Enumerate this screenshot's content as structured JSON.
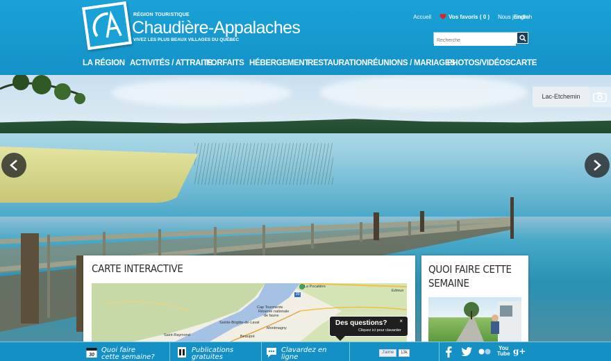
{
  "brand": {
    "kicker": "RÉGION TOURISTIQUE",
    "name": "Chaudière-Appalaches",
    "tagline": "VIVEZ LES PLUS BEAUX VILLAGES DU QUÉBEC"
  },
  "toplinks": {
    "home": "Accueil",
    "favorites": "Vos favoris ( 0 )",
    "contact": "Nous joindre",
    "language": "English"
  },
  "search": {
    "placeholder": "Recherche"
  },
  "nav": [
    "LA RÉGION",
    "ACTIVITÉS / ATTRAITS",
    "FORFAITS",
    "HÉBERGEMENT",
    "RESTAURATION",
    "RÉUNIONS / MARIAGES",
    "PHOTOS/VIDÉOS",
    "CARTE"
  ],
  "hero": {
    "location": "Lac-Etchemin"
  },
  "panels": {
    "map_title": "CARTE INTERACTIVE",
    "week_title": "QUOI FAIRE CETTE SEMAINE",
    "map_labels": {
      "pocatiere": "La Pocatière",
      "edmun": "Edmun",
      "tourmente": "Cap Tourmente",
      "reserve1": "Réserve nationale",
      "reserve2": "de faune",
      "brigitte": "Sainte-Brigitte-de-Laval",
      "montmagny": "Montmagny",
      "raymond": "Saint-Raymond",
      "beaupre": "Beaupré"
    },
    "route_number": "20"
  },
  "chat": {
    "title": "Des questions?",
    "subtitle": "Cliquez ici pour clavarder",
    "close": "×"
  },
  "footer": {
    "calendar_day": "30",
    "item1_line1": "Quoi faire",
    "item1_line2": "cette semaine?",
    "item2_line1": "Publications",
    "item2_line2": "gratuites",
    "item3_line1": "Clavardez en",
    "item3_line2": "ligne",
    "fb_like": "J'aime",
    "fb_count": "13k",
    "youtube_1": "You",
    "youtube_2": "Tube"
  },
  "colors": {
    "header_blue": "#1aa2d8",
    "footer_blue": "#1590c4",
    "heart_red": "#d7262d"
  }
}
